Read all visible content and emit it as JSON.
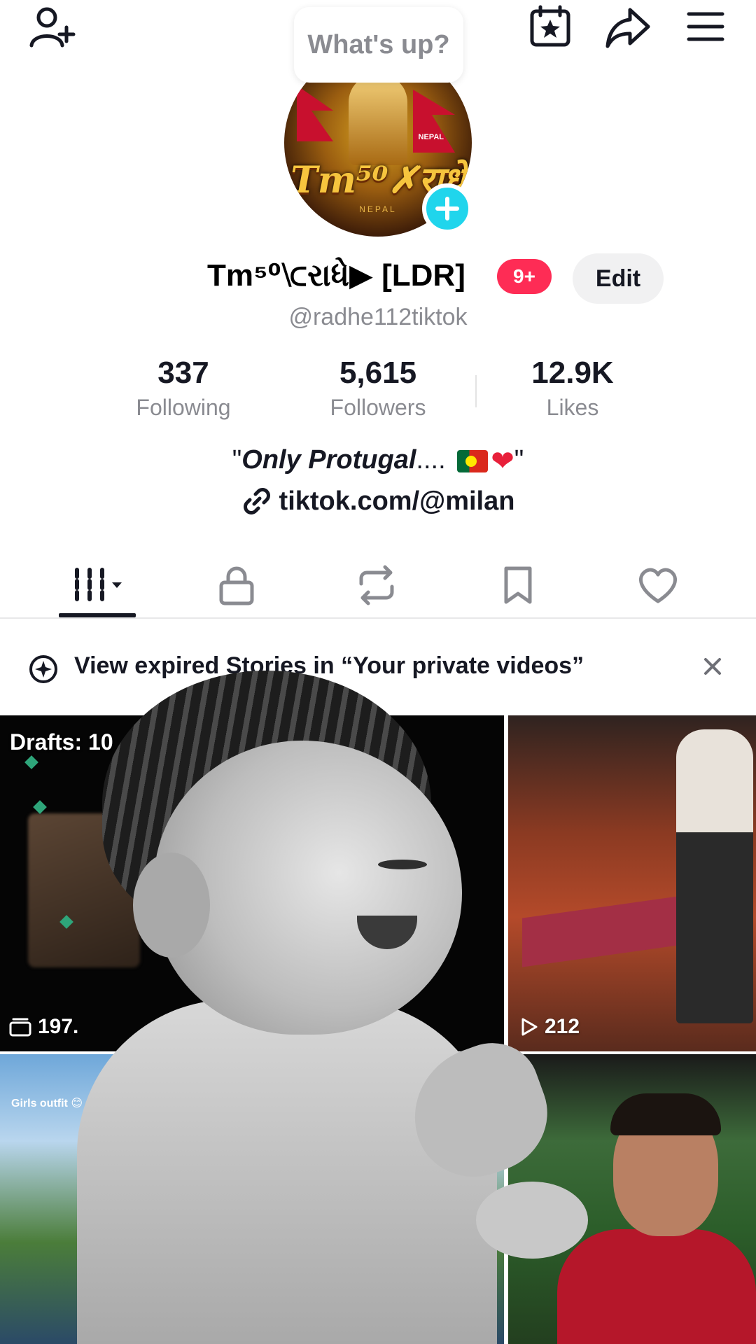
{
  "header": {
    "status_prompt": "What's up?",
    "icons": [
      "add-friend-icon",
      "creator-calendar-icon",
      "share-icon",
      "menu-icon"
    ]
  },
  "profile": {
    "avatar": {
      "brand_text": "Tm⁵⁰✗राधे",
      "country_text": "NEPAL",
      "flag_text": "NEPAL"
    },
    "display_name": "Tm⁵⁰⟈રાધે▶ [LDR]",
    "notification_badge": "9+",
    "edit_label": "Edit",
    "username": "@radhe112tiktok"
  },
  "stats": [
    {
      "value": "337",
      "label": "Following"
    },
    {
      "value": "5,615",
      "label": "Followers"
    },
    {
      "value": "12.9K",
      "label": "Likes"
    }
  ],
  "bio": {
    "open_quote": "\"",
    "text": "Only Protugal",
    "ellipsis": "....",
    "close_quote": "\"",
    "link": "tiktok.com/@milan"
  },
  "tabs": [
    "videos-grid",
    "private",
    "reposts",
    "favorites",
    "liked"
  ],
  "banner": {
    "text": "View expired Stories in “Your private videos”"
  },
  "grid": {
    "drafts_label": "Drafts: 10",
    "cell1_views": "197.",
    "cell2_views": "212",
    "cell3_caption": "Girls outfit 😊"
  },
  "colors": {
    "accent_red": "#fe2c55",
    "accent_cyan": "#20d5ec",
    "text_primary": "#161823",
    "text_secondary": "#8a8b91"
  }
}
